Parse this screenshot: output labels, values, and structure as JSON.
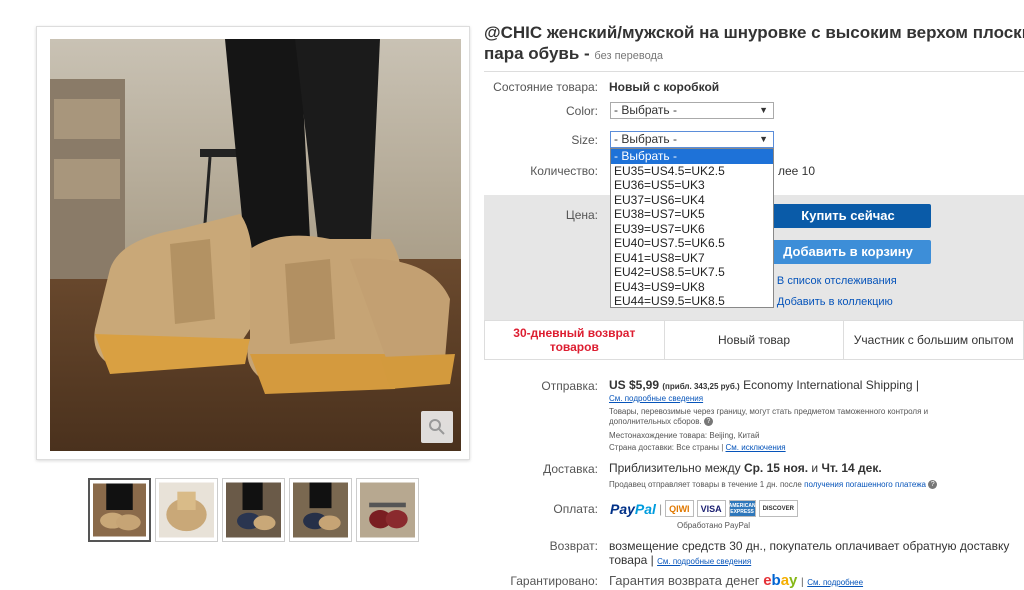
{
  "title": {
    "line1": "@CHIC женский/мужской на шнуровке с высоким верхом плоский теп",
    "line2": "пара обувь -",
    "untranslated": "без перевода"
  },
  "condition": {
    "label": "Состояние товара:",
    "value": "Новый с коробкой"
  },
  "color": {
    "label": "Color:",
    "selected": "- Выбрать -"
  },
  "size": {
    "label": "Size:",
    "selected": "- Выбрать -",
    "options": [
      "- Выбрать -",
      "EU35=US4.5=UK2.5",
      "EU36=US5=UK3",
      "EU37=US6=UK4",
      "EU38=US7=UK5",
      "EU39=US7=UK6",
      "EU40=US7.5=UK6.5",
      "EU41=US8=UK7",
      "EU42=US8.5=UK7.5",
      "EU43=US9=UK8",
      "EU44=US9.5=UK8.5"
    ]
  },
  "quantity": {
    "label": "Количество:",
    "more_than": "лее 10"
  },
  "price": {
    "label": "Цена:"
  },
  "actions": {
    "buy_now": "Купить сейчас",
    "add_to_cart": "Добавить в корзину",
    "watchlist": "В список отслеживания",
    "collection": "Добавить в коллекцию"
  },
  "badges": [
    "30-дневный возврат товаров",
    "Новый товар",
    "Участник с большим опытом"
  ],
  "shipping": {
    "label": "Отправка:",
    "price": "US $5,99",
    "approx": "(прибл. 343,25 руб.)",
    "service": "Economy International Shipping |",
    "details_link": "См. подробные сведения",
    "customs_note": "Товары, перевозимые через границу, могут стать предметом таможенного контроля и дополнительных сборов.",
    "location": "Местонахождение товара: Beijing, Китай",
    "ships_to_prefix": "Страна доставки: Все страны",
    "exceptions_link": "См. исключения"
  },
  "delivery": {
    "label": "Доставка:",
    "text_prefix": "Приблизительно между",
    "date1": "Ср. 15 ноя.",
    "and": "и",
    "date2": "Чт. 14 дек.",
    "note_prefix": "Продавец отправляет товары в течение 1 дн. после",
    "note_link": "получения погашенного платежа"
  },
  "payment": {
    "label": "Оплата:",
    "paypal_processed": "Обработано PayPal",
    "logos": [
      "QIWI",
      "VISA",
      "AMERICAN EXPRESS",
      "DISCOVER"
    ]
  },
  "returns": {
    "label": "Возврат:",
    "text": "возмещение средств 30 дн., покупатель оплачивает обратную доставку",
    "text2": "товара |",
    "details_link": "См. подробные сведения"
  },
  "guarantee": {
    "label": "Гарантировано:",
    "text": "Гарантия возврата денег",
    "more_link": "См. подробнее"
  },
  "colors": {
    "accent": "#0654ba",
    "buy": "#0a5ba8",
    "cart": "#3d8ed8",
    "red": "#dd1e31"
  }
}
